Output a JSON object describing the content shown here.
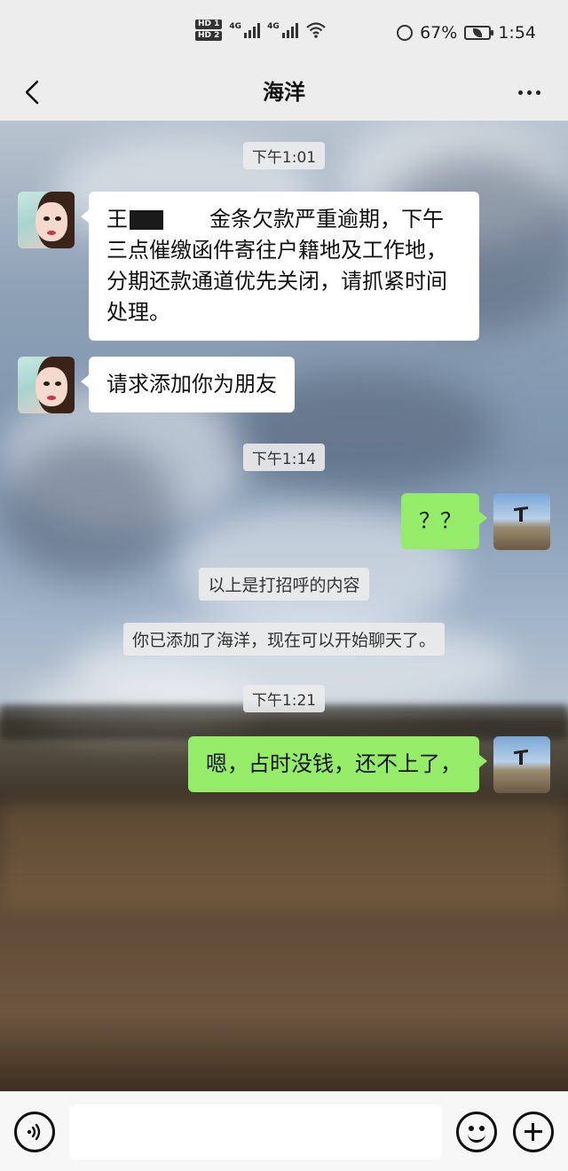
{
  "status_bar": {
    "hd1": "HD 1",
    "hd2": "HD 2",
    "network1": "4G",
    "network2": "4G",
    "battery": "67%",
    "time": "1:54"
  },
  "header": {
    "title": "海洋",
    "back_icon": "chevron-left-icon",
    "more_icon": "more-dots-icon"
  },
  "chat": {
    "timestamps": [
      "下午1:01",
      "下午1:14",
      "下午1:21"
    ],
    "messages": [
      {
        "side": "left",
        "prefix": "王",
        "text_line1_after_redact": "金条欠款严重逾期，下午",
        "text_rest": "三点催缴函件寄往户籍地及工作地，分期还款通道优先关闭，请抓紧时间处理。"
      },
      {
        "side": "left",
        "text": "请求添加你为朋友"
      },
      {
        "side": "right",
        "text": "？？"
      },
      {
        "side": "right",
        "text": "嗯，占时没钱，还不上了，"
      }
    ],
    "system": [
      "以上是打招呼的内容",
      "你已添加了海洋，现在可以开始聊天了。"
    ]
  },
  "input_bar": {
    "voice_icon": "voice-icon",
    "emoji_icon": "emoji-icon",
    "plus_icon": "plus-icon",
    "placeholder": ""
  },
  "colors": {
    "sent_bubble": "#95ec69",
    "received_bubble": "#ffffff",
    "chrome": "#ededed"
  }
}
